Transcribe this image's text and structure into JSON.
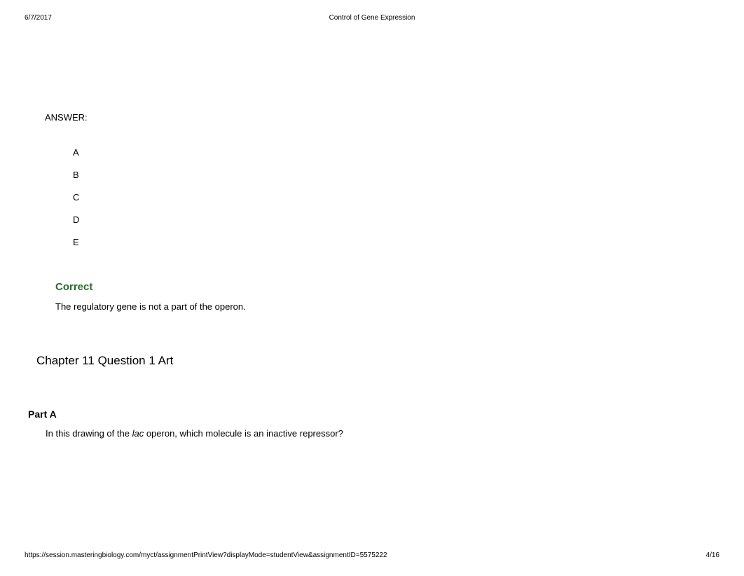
{
  "header": {
    "date": "6/7/2017",
    "title": "Control of Gene Expression"
  },
  "answer": {
    "label": "ANSWER:",
    "options": [
      "A",
      "B",
      "C",
      "D",
      "E"
    ]
  },
  "feedback": {
    "status": "Correct",
    "explanation": "The regulatory gene is not a part of the operon."
  },
  "chapter": {
    "title": "Chapter 11 Question 1  Art"
  },
  "part": {
    "label": "Part A",
    "question_prefix": "In this drawing of the ",
    "question_italic": "lac",
    "question_suffix": " operon, which molecule is an inactive repressor?"
  },
  "footer": {
    "url": "https://session.masteringbiology.com/myct/assignmentPrintView?displayMode=studentView&assignmentID=5575222",
    "page": "4/16"
  }
}
